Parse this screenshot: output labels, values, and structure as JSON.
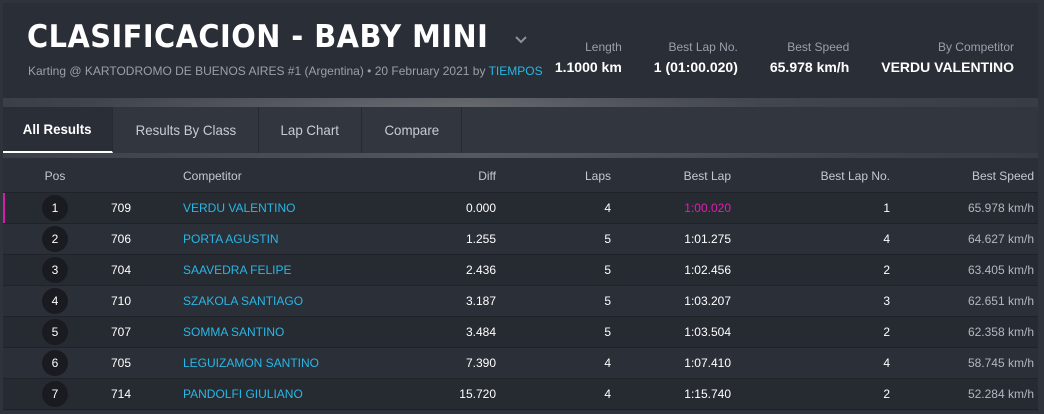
{
  "header": {
    "title": "CLASIFICACION - BABY MINI",
    "subtitle_prefix": "Karting @ KARTODROMO DE BUENOS AIRES #1 (Argentina) • 20 February 2021 by",
    "subtitle_link": "TIEMPOS"
  },
  "stats": [
    {
      "label": "Length",
      "value": "1.1000 km"
    },
    {
      "label": "Best Lap No.",
      "value": "1 (01:00.020)"
    },
    {
      "label": "Best Speed",
      "value": "65.978 km/h"
    },
    {
      "label": "By Competitor",
      "value": "VERDU VALENTINO"
    }
  ],
  "tabs": [
    {
      "label": "All Results",
      "active": true
    },
    {
      "label": "Results By Class",
      "active": false
    },
    {
      "label": "Lap Chart",
      "active": false
    },
    {
      "label": "Compare",
      "active": false
    }
  ],
  "table": {
    "columns": {
      "pos": "Pos",
      "competitor": "Competitor",
      "diff": "Diff",
      "laps": "Laps",
      "best_lap": "Best Lap",
      "best_lap_no": "Best Lap No.",
      "best_speed": "Best Speed"
    },
    "rows": [
      {
        "pos": "1",
        "num": "709",
        "competitor": "VERDU VALENTINO",
        "diff": "0.000",
        "laps": "4",
        "best_lap": "1:00.020",
        "best_lap_no": "1",
        "best_speed": "65.978 km/h"
      },
      {
        "pos": "2",
        "num": "706",
        "competitor": "PORTA AGUSTIN",
        "diff": "1.255",
        "laps": "5",
        "best_lap": "1:01.275",
        "best_lap_no": "4",
        "best_speed": "64.627 km/h"
      },
      {
        "pos": "3",
        "num": "704",
        "competitor": "SAAVEDRA FELIPE",
        "diff": "2.436",
        "laps": "5",
        "best_lap": "1:02.456",
        "best_lap_no": "2",
        "best_speed": "63.405 km/h"
      },
      {
        "pos": "4",
        "num": "710",
        "competitor": "SZAKOLA SANTIAGO",
        "diff": "3.187",
        "laps": "5",
        "best_lap": "1:03.207",
        "best_lap_no": "3",
        "best_speed": "62.651 km/h"
      },
      {
        "pos": "5",
        "num": "707",
        "competitor": "SOMMA SANTINO",
        "diff": "3.484",
        "laps": "5",
        "best_lap": "1:03.504",
        "best_lap_no": "2",
        "best_speed": "62.358 km/h"
      },
      {
        "pos": "6",
        "num": "705",
        "competitor": "LEGUIZAMON SANTINO",
        "diff": "7.390",
        "laps": "4",
        "best_lap": "1:07.410",
        "best_lap_no": "4",
        "best_speed": "58.745 km/h"
      },
      {
        "pos": "7",
        "num": "714",
        "competitor": "PANDOLFI GIULIANO",
        "diff": "15.720",
        "laps": "4",
        "best_lap": "1:15.740",
        "best_lap_no": "2",
        "best_speed": "52.284 km/h"
      }
    ]
  },
  "colors": {
    "accent_link": "#29b7e6",
    "best_lap_highlight": "#e01fb4"
  }
}
